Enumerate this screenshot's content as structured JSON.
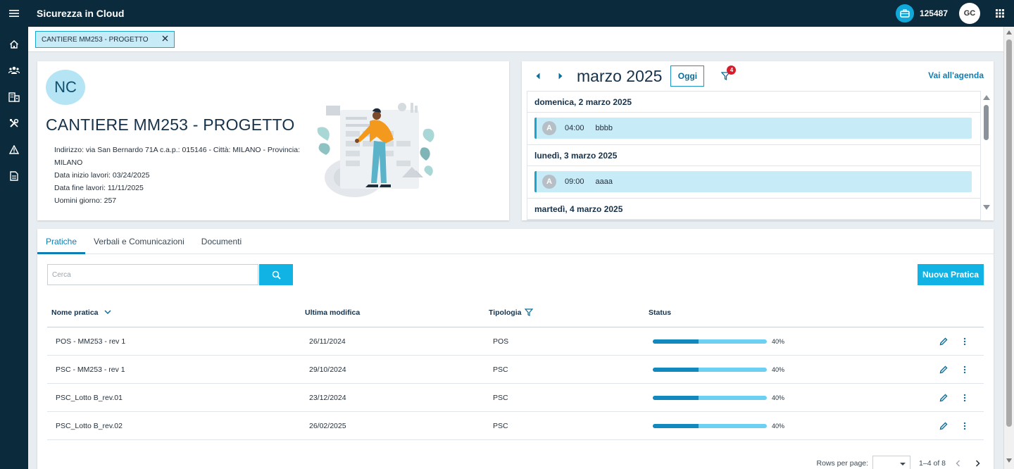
{
  "app": {
    "title": "Sicurezza in Cloud",
    "company_code": "125487",
    "user_initials": "GC"
  },
  "sidebar": {
    "items": [
      {
        "name": "home",
        "icon": "home-icon"
      },
      {
        "name": "users",
        "icon": "users-icon"
      },
      {
        "name": "buildings",
        "icon": "building-icon"
      },
      {
        "name": "tools",
        "icon": "tools-icon"
      },
      {
        "name": "warning",
        "icon": "warning-icon"
      },
      {
        "name": "documents",
        "icon": "document-icon"
      }
    ]
  },
  "project_tab": {
    "label": "CANTIERE MM253 - PROGETTO"
  },
  "info": {
    "initials": "NC",
    "title": "CANTIERE MM253 - PROGETTO",
    "address": "Indirizzo: via San Bernardo 71A c.a.p.: 015146 - Città: MILANO - Provincia: MILANO",
    "start": "Data inizio lavori: 03/24/2025",
    "end": "Data fine lavori: 11/11/2025",
    "men_days": "Uomini giorno: 257"
  },
  "calendar": {
    "month": "marzo 2025",
    "today_label": "Oggi",
    "filter_count": "4",
    "agenda_link": "Vai all'agenda",
    "days": [
      {
        "label": "domenica, 2 marzo 2025",
        "events": [
          {
            "initial": "A",
            "time": "04:00",
            "title": "bbbb"
          }
        ]
      },
      {
        "label": "lunedì, 3 marzo 2025",
        "events": [
          {
            "initial": "A",
            "time": "09:00",
            "title": "aaaa"
          }
        ]
      },
      {
        "label": "martedì, 4 marzo 2025",
        "events": []
      }
    ]
  },
  "pratiche": {
    "tabs": [
      "Pratiche",
      "Verbali e Comunicazioni",
      "Documenti"
    ],
    "search_placeholder": "Cerca",
    "new_button": "Nuova Pratica",
    "columns": {
      "name": "Nome pratica",
      "modified": "Ultima modifica",
      "type": "Tipologia",
      "status": "Status"
    },
    "rows": [
      {
        "name": "POS - MM253 - rev 1",
        "modified": "26/11/2024",
        "type": "POS",
        "progress": 40,
        "progress_label": "40%"
      },
      {
        "name": "PSC - MM253 - rev 1",
        "modified": "29/10/2024",
        "type": "PSC",
        "progress": 40,
        "progress_label": "40%"
      },
      {
        "name": "PSC_Lotto B_rev.01",
        "modified": "23/12/2024",
        "type": "PSC",
        "progress": 40,
        "progress_label": "40%"
      },
      {
        "name": "PSC_Lotto B_rev.02",
        "modified": "26/02/2025",
        "type": "PSC",
        "progress": 40,
        "progress_label": "40%"
      }
    ],
    "pager": {
      "rows_per_page_label": "Rows per page:",
      "range": "1–4 of 8"
    }
  },
  "colors": {
    "topbar": "#0b2a3c",
    "accent": "#10b3e3",
    "event_bg": "#c7ecf8",
    "progress_fill": "#1189be",
    "progress_track": "#6dd0f3",
    "badge": "#d91b2a"
  }
}
